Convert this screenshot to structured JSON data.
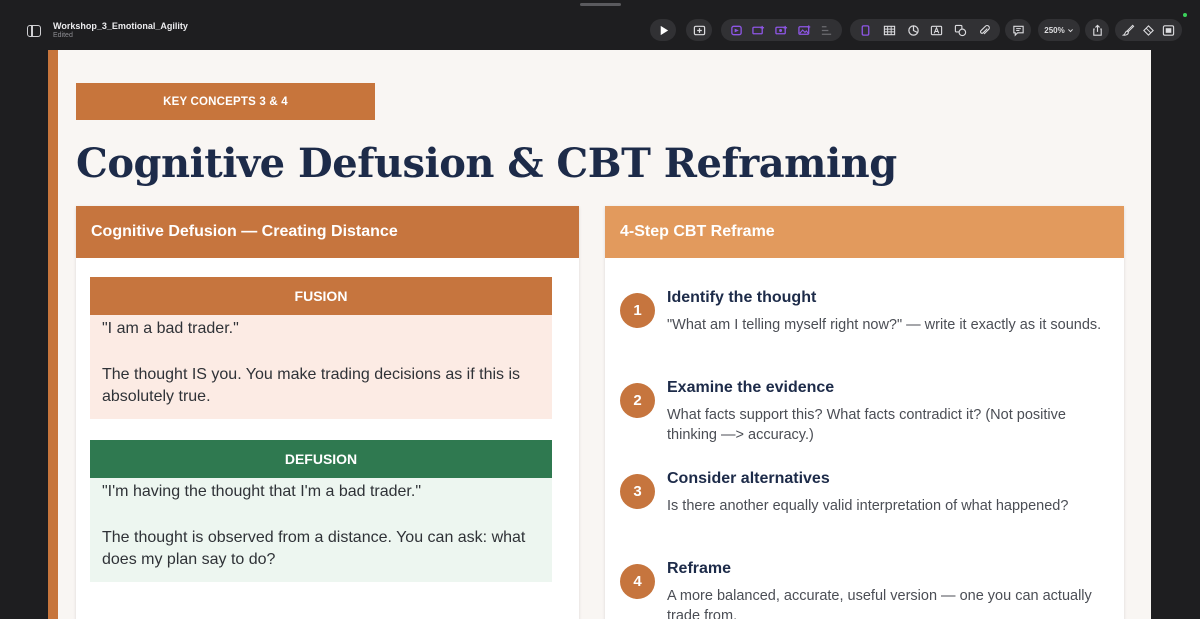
{
  "window": {
    "title": "Workshop_3_Emotional_Agility",
    "status": "Edited"
  },
  "toolbar": {
    "zoom": "250%",
    "accent_color": "#8e56e6"
  },
  "slide": {
    "tag": "KEY CONCEPTS 3 & 4",
    "title": "Cognitive Defusion & CBT Reframing",
    "left_panel": {
      "header": "Cognitive Defusion — Creating Distance",
      "fusion": {
        "heading": "FUSION",
        "quote": "\"I am a bad trader.\"",
        "explanation": "The thought IS you. You make trading decisions as if this is absolutely true."
      },
      "defusion": {
        "heading": "DEFUSION",
        "quote": "\"I'm having the thought that I'm a bad trader.\"",
        "explanation": "The thought is observed from a distance. You can ask: what does my plan say to do?"
      }
    },
    "right_panel": {
      "header": "4-Step CBT Reframe",
      "steps": [
        {
          "number": "1",
          "title": "Identify the thought",
          "description": "\"What am I telling myself right now?\" — write it exactly as it sounds."
        },
        {
          "number": "2",
          "title": "Examine the evidence",
          "description": "What facts support this? What facts contradict it? (Not positive thinking —> accuracy.)"
        },
        {
          "number": "3",
          "title": "Consider alternatives",
          "description": "Is there another equally valid interpretation of what happened?"
        },
        {
          "number": "4",
          "title": "Reframe",
          "description": "A more balanced, accurate, useful version — one you can actually trade from."
        }
      ]
    },
    "colors": {
      "accent_orange": "#c6753e",
      "light_orange": "#e29a5d",
      "green": "#2f7950",
      "navy": "#1d2b49"
    }
  }
}
